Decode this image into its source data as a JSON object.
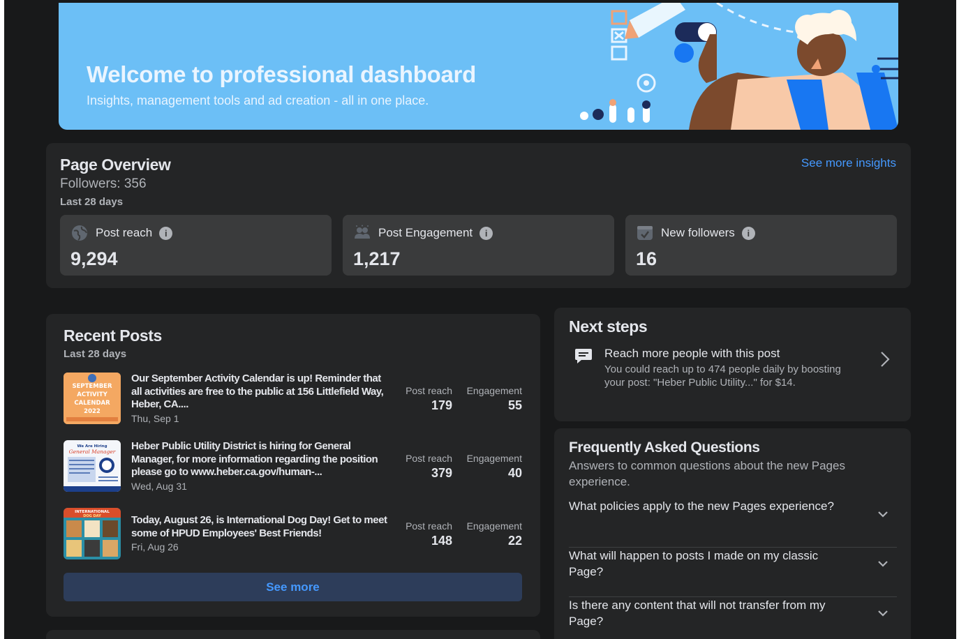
{
  "banner": {
    "title": "Welcome to professional dashboard",
    "subtitle": "Insights, management tools and ad creation - all in one place."
  },
  "overview": {
    "title": "Page Overview",
    "followers": "Followers: 356",
    "period": "Last 28 days",
    "see_more": "See more insights",
    "stats": [
      {
        "label": "Post reach",
        "value": "9,294",
        "icon": "globe-icon"
      },
      {
        "label": "Post Engagement",
        "value": "1,217",
        "icon": "people-icon"
      },
      {
        "label": "New followers",
        "value": "16",
        "icon": "checkbox-icon"
      }
    ]
  },
  "recent": {
    "title": "Recent Posts",
    "period": "Last 28 days",
    "reach_label": "Post reach",
    "engagement_label": "Engagement",
    "posts": [
      {
        "text": "Our September Activity Calendar is up! Reminder that all activities are free to the public at 156 Littlefield Way, Heber, CA....",
        "date": "Thu, Sep 1",
        "reach": "179",
        "engagement": "55",
        "thumb_text": [
          "SEPTEMBER",
          "ACTIVITY",
          "CALENDAR",
          "2022"
        ]
      },
      {
        "text": "Heber Public Utility District is hiring for General Manager, for more information regarding the position please go to www.heber.ca.gov/human-...",
        "date": "Wed, Aug 31",
        "reach": "379",
        "engagement": "40",
        "thumb_text": [
          "We Are Hiring",
          "General Manager"
        ]
      },
      {
        "text": "Today, August 26, is International Dog Day! Get to meet some of HPUD Employees' Best Friends!",
        "date": "Fri, Aug 26",
        "reach": "148",
        "engagement": "22",
        "thumb_text": [
          "INTERNATIONAL",
          "DOG DAY"
        ]
      }
    ],
    "see_more": "See more"
  },
  "next_steps": {
    "title": "Next steps",
    "item_title": "Reach more people with this post",
    "item_desc": "You could reach up to 474 people daily by boosting your post: \"Heber Public Utility...\" for $14."
  },
  "faq": {
    "title": "Frequently Asked Questions",
    "subtitle": "Answers to common questions about the new Pages experience.",
    "questions": [
      "What policies apply to the new Pages experience?",
      "What will happen to posts I made on my classic Page?",
      "Is there any content that will not transfer from my Page?"
    ]
  },
  "colors": {
    "background": "#18191a",
    "card": "#242526",
    "stat_card": "#3a3b3c",
    "accent_link": "#4599ff",
    "banner": "#6cbff6"
  }
}
